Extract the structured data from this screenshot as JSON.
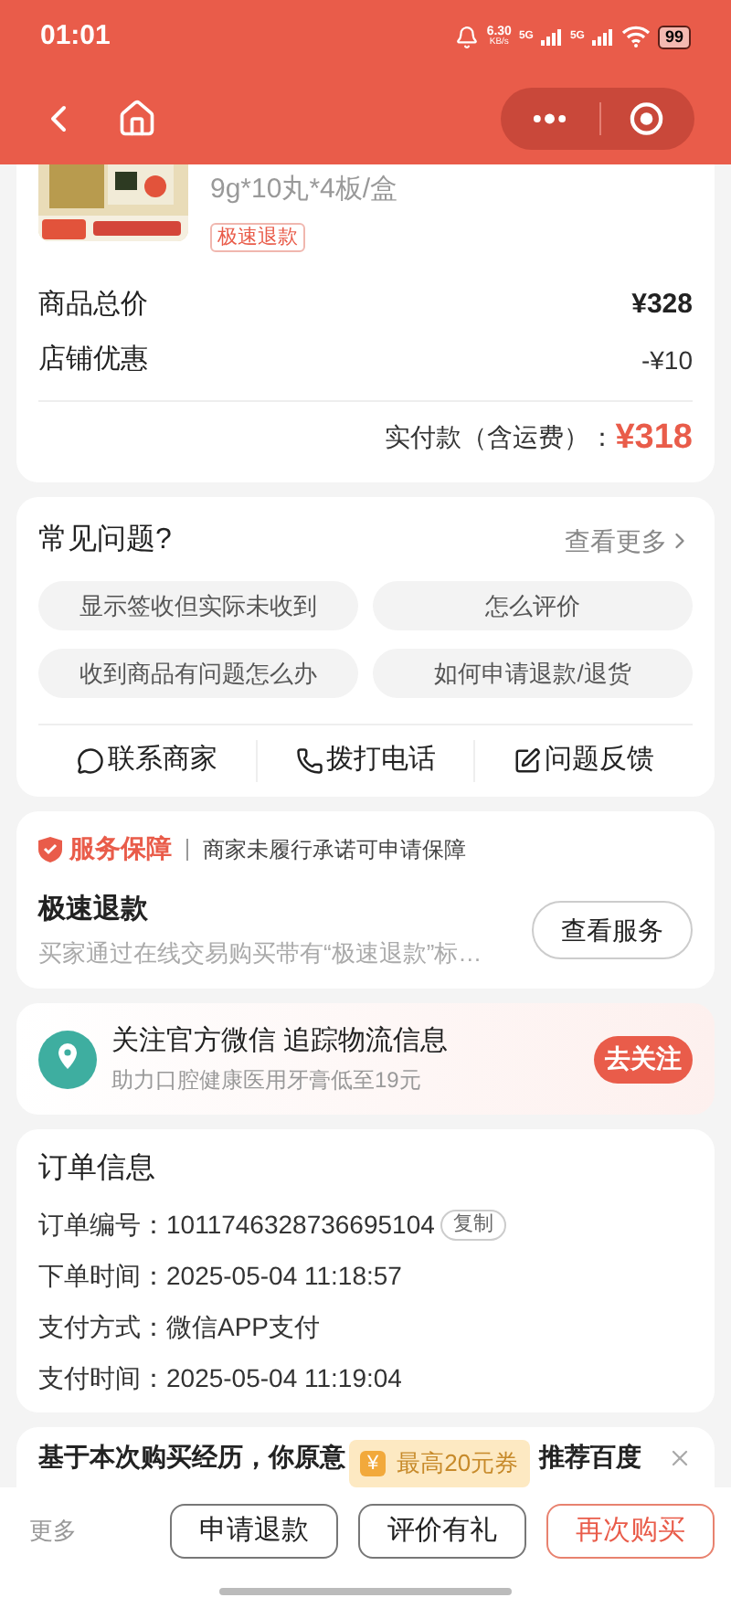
{
  "status_bar": {
    "time": "01:01",
    "net_speed": "6.30",
    "net_unit": "KB/s",
    "sim1": "5G",
    "sim2": "5G",
    "battery": "99"
  },
  "product": {
    "spec": "9g*10丸*4板/盒",
    "tag": "极速退款"
  },
  "prices": [
    {
      "label": "商品总价",
      "value": "¥328",
      "kind": "bold"
    },
    {
      "label": "店铺优惠",
      "value": "-¥10",
      "kind": "plain"
    }
  ],
  "total": {
    "label": "实付款（含运费）：",
    "value": "¥318"
  },
  "faq": {
    "title": "常见问题?",
    "more": "查看更多",
    "questions": [
      "显示签收但实际未收到",
      "怎么评价",
      "收到商品有问题怎么办",
      "如何申请退款/退货"
    ],
    "actions": [
      {
        "kind": "chat",
        "label": "联系商家"
      },
      {
        "kind": "phone",
        "label": "拨打电话"
      },
      {
        "kind": "feedback",
        "label": "问题反馈"
      }
    ]
  },
  "service": {
    "badge": "服务保障",
    "note": "商家未履行承诺可申请保障",
    "title": "极速退款",
    "desc": "买家通过在线交易购买带有“极速退款”标…",
    "button": "查看服务"
  },
  "wechat": {
    "title": "关注官方微信 追踪物流信息",
    "subtitle": "助力口腔健康医用牙膏低至19元",
    "button": "去关注"
  },
  "order": {
    "title": "订单信息",
    "rows": [
      {
        "label": "订单编号：",
        "value": "1011746328736695104",
        "copy": "复制"
      },
      {
        "label": "下单时间：",
        "value": "2025-05-04 11:18:57"
      },
      {
        "label": "支付方式：",
        "value": "微信APP支付"
      },
      {
        "label": "支付时间：",
        "value": "2025-05-04 11:19:04"
      }
    ]
  },
  "survey": {
    "text_start": "基于本次购买经历，你原意",
    "text_end": "推荐百度"
  },
  "coupon": {
    "icon": "¥",
    "text": "最高20元券"
  },
  "bottom_bar": {
    "more": "更多",
    "buttons": [
      {
        "label": "申请退款",
        "primary": false
      },
      {
        "label": "评价有礼",
        "primary": false
      },
      {
        "label": "再次购买",
        "primary": true
      }
    ]
  }
}
